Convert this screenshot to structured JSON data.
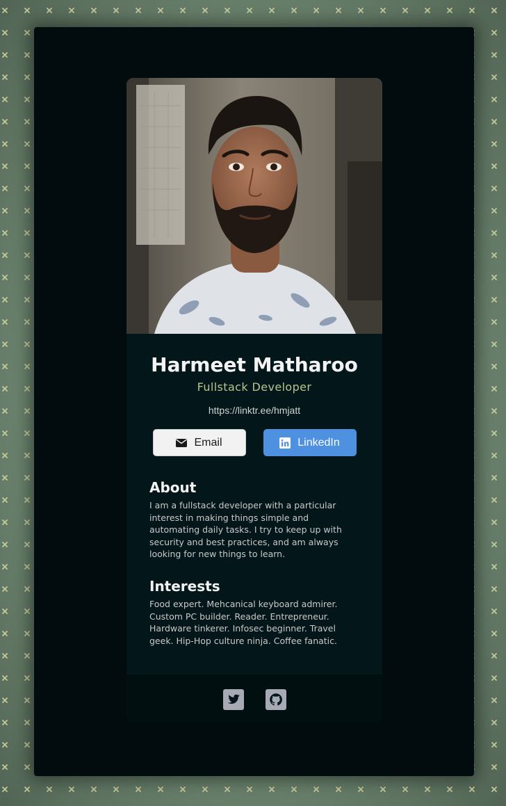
{
  "profile": {
    "name": "Harmeet Matharoo",
    "role": "Fullstack Developer",
    "link": "https://linktr.ee/hmjatt"
  },
  "buttons": {
    "email_label": "Email",
    "email_icon": "envelope-icon",
    "linkedin_label": "LinkedIn",
    "linkedin_icon": "linkedin-icon"
  },
  "about": {
    "heading": "About",
    "text": "I am a fullstack developer with a particular interest in making things simple and automating daily tasks. I try to keep up with security and best practices, and am always looking for new things to learn."
  },
  "interests": {
    "heading": "Interests",
    "text": "Food expert. Mehcanical keyboard admirer. Custom PC builder. Reader. Entrepreneur. Hardware tinkerer. Infosec beginner. Travel geek. Hip-Hop culture ninja. Coffee fanatic."
  },
  "footer": {
    "icons": [
      "twitter-icon",
      "github-icon"
    ]
  },
  "colors": {
    "background": "#6d8670",
    "frame": "#020c0e",
    "card": "#03171a",
    "accent_title": "#b9c48f",
    "linkedin_button": "#4e91e0",
    "email_button": "#f2f2f2",
    "social_icon": "#a7a9b4"
  }
}
